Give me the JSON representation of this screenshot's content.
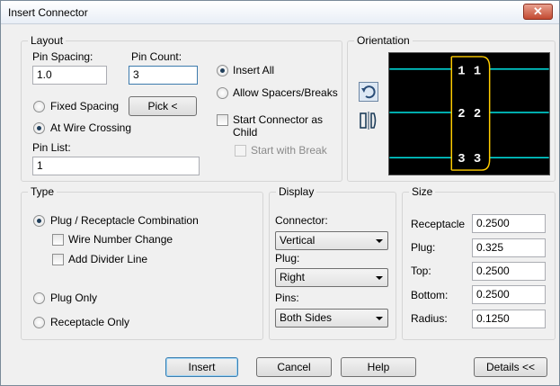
{
  "window": {
    "title": "Insert Connector",
    "close_glyph": "✕"
  },
  "layout": {
    "group_label": "Layout",
    "pin_spacing_label": "Pin Spacing:",
    "pin_spacing_value": "1.0",
    "pin_count_label": "Pin Count:",
    "pin_count_value": "3",
    "fixed_spacing_label": "Fixed Spacing",
    "pick_button_label": "Pick <",
    "at_wire_crossing_label": "At Wire Crossing",
    "pin_list_label": "Pin List:",
    "pin_list_value": "1",
    "insert_all_label": "Insert All",
    "allow_spacers_label": "Allow Spacers/Breaks",
    "start_connector_child_label_1": "Start Connector as",
    "start_connector_child_label_2": "Child",
    "start_with_break_label": "Start with Break"
  },
  "orientation": {
    "group_label": "Orientation",
    "pins_left": [
      "1",
      "2",
      "3"
    ],
    "pins_right": [
      "1",
      "2",
      "3"
    ],
    "colors": {
      "wire": "#00e5e5",
      "body": "#ffcc00",
      "text": "#ffffff",
      "background": "#000000"
    },
    "icons": [
      "rotate-icon",
      "flip-icon"
    ]
  },
  "type": {
    "group_label": "Type",
    "plug_receptacle_label": "Plug / Receptacle Combination",
    "wire_number_change_label": "Wire Number Change",
    "add_divider_line_label": "Add Divider Line",
    "plug_only_label": "Plug Only",
    "receptacle_only_label": "Receptacle Only"
  },
  "display": {
    "group_label": "Display",
    "connector_label": "Connector:",
    "connector_value": "Vertical",
    "plug_label": "Plug:",
    "plug_value": "Right",
    "pins_label": "Pins:",
    "pins_value": "Both Sides"
  },
  "size": {
    "group_label": "Size",
    "receptacle_label": "Receptacle",
    "receptacle_value": "0.2500",
    "plug_label": "Plug:",
    "plug_value": "0.325",
    "top_label": "Top:",
    "top_value": "0.2500",
    "bottom_label": "Bottom:",
    "bottom_value": "0.2500",
    "radius_label": "Radius:",
    "radius_value": "0.1250"
  },
  "buttons": {
    "insert": "Insert",
    "cancel": "Cancel",
    "help": "Help",
    "details": "Details <<"
  }
}
